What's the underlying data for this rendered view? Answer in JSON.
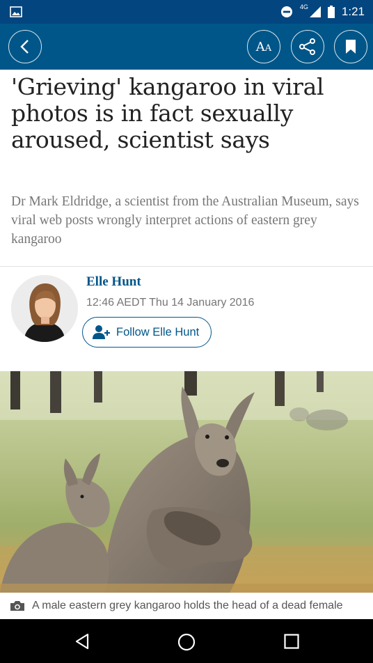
{
  "status_bar": {
    "network": "4G",
    "time": "1:21"
  },
  "toolbar": {
    "back_icon": "chevron-left-icon",
    "text_size_label": "AA",
    "share_icon": "share-icon",
    "bookmark_icon": "bookmark-icon"
  },
  "article": {
    "headline": "'Grieving' kangaroo in viral photos is in fact sexually aroused, scientist says",
    "standfirst": "Dr Mark Eldridge, a scientist from the Australian Museum, says viral web posts wrongly interpret actions of eastern grey kangaroo",
    "author": {
      "name": "Elle Hunt",
      "timestamp": "12:46 AEDT Thu 14 January 2016",
      "follow_label": "Follow Elle Hunt"
    },
    "image_caption": "A male eastern grey kangaroo holds the head of a dead female"
  },
  "colors": {
    "brand": "#005689",
    "status_bar": "#02457f",
    "headline": "#222222",
    "standfirst": "#767676"
  }
}
